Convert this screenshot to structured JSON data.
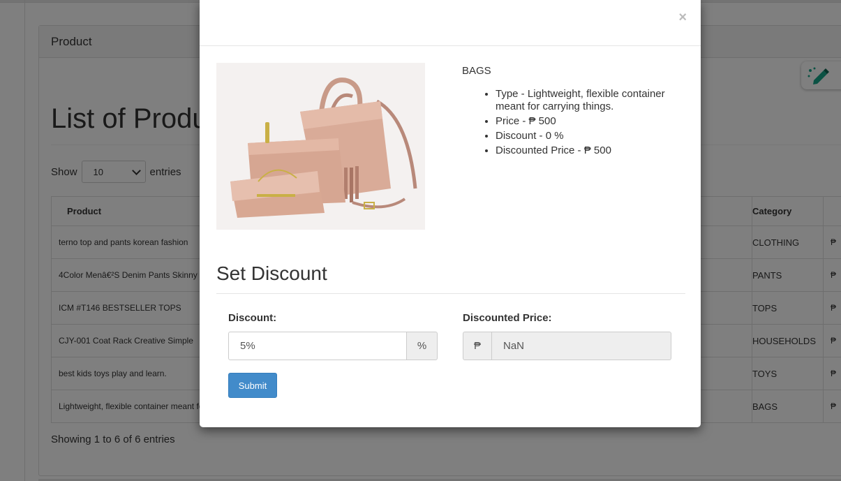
{
  "background": {
    "panel_title": "Product",
    "page_title": "List of Products",
    "show_label": "Show",
    "page_length": "10",
    "entries_label": "entries",
    "columns": [
      "Product",
      "Category"
    ],
    "rows": [
      {
        "product": "terno top and pants korean fashion",
        "category": "CLOTHING",
        "price": "₱"
      },
      {
        "product": "4Color Menâ€²S Denim Pants Skinny",
        "category": "PANTS",
        "price": "₱"
      },
      {
        "product": "ICM #T146 BESTSELLER TOPS",
        "category": "TOPS",
        "price": "₱"
      },
      {
        "product": "CJY-001 Coat Rack Creative Simple",
        "category": "HOUSEHOLDS",
        "price": "₱"
      },
      {
        "product": "best kids toys play and learn.",
        "category": "TOYS",
        "price": "₱"
      },
      {
        "product": "Lightweight, flexible container meant for carrying things.",
        "category": "BAGS",
        "price": "₱"
      }
    ],
    "footer_info": "Showing 1 to 6 of 6 entries"
  },
  "modal": {
    "close_glyph": "×",
    "product_name": "BAGS",
    "specs": [
      "Type - Lightweight, flexible container meant for carrying things.",
      "Price - ₱ 500",
      "Discount - 0 %",
      "Discounted Price - ₱ 500"
    ],
    "section_title": "Set Discount",
    "discount_label": "Discount:",
    "discount_value": "5%",
    "discount_addon": "%",
    "discounted_price_label": "Discounted Price:",
    "peso_addon": "₱",
    "discounted_price_value": "NaN",
    "submit_label": "Submit"
  },
  "colors": {
    "primary_button": "#428bca",
    "overlay": "rgba(0,0,0,0.5)"
  }
}
